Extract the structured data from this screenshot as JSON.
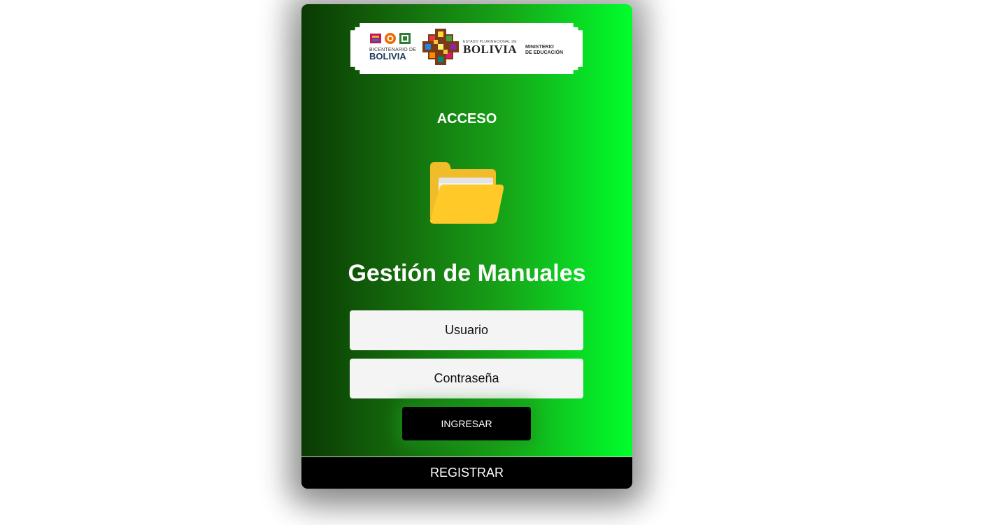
{
  "banner": {
    "bicentenario_small": "BICENTENARIO DE",
    "bicentenario_big": "BOLIVIA",
    "estado_small": "ESTADO PLURINACIONAL DE",
    "estado_big": "BOLIVIA",
    "ministerio_line1": "MINISTERIO",
    "ministerio_line2": "DE EDUCACIÓN"
  },
  "login": {
    "heading": "ACCESO",
    "icon": "folder-icon",
    "title": "Gestión de Manuales",
    "username_placeholder": "Usuario",
    "password_placeholder": "Contraseña",
    "submit_label": "INGRESAR",
    "register_label": "REGISTRAR"
  },
  "colors": {
    "gradient_start": "#0a3a03",
    "gradient_end": "#00ff2c",
    "folder": "#ffca28",
    "button": "#000000"
  }
}
